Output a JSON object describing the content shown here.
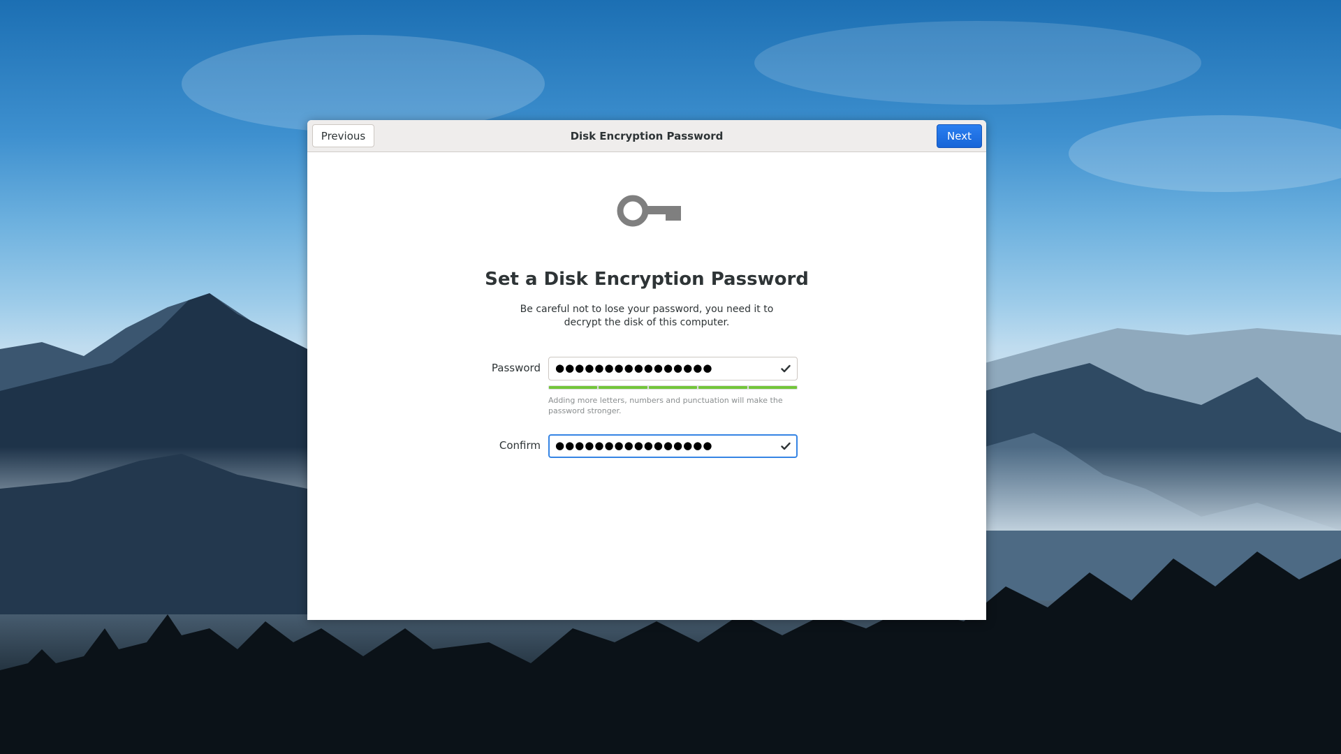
{
  "dialog": {
    "title": "Disk Encryption Password",
    "previous_label": "Previous",
    "next_label": "Next"
  },
  "page": {
    "icon": "key-icon",
    "heading": "Set a Disk Encryption Password",
    "description": "Be careful not to lose your password, you need it to decrypt the disk of this computer."
  },
  "password": {
    "label": "Password",
    "masked_value": "●●●●●●●●●●●●●●●●",
    "status_icon": "check-icon",
    "strength_fraction": 1.0,
    "hint": "Adding more letters, numbers and punctuation will make the password stronger."
  },
  "confirm": {
    "label": "Confirm",
    "masked_value": "●●●●●●●●●●●●●●●●",
    "status_icon": "check-icon",
    "focused": true
  },
  "colors": {
    "accent": "#1a73e8",
    "strength": "#73c63a",
    "focus_ring": "#3584e4"
  }
}
